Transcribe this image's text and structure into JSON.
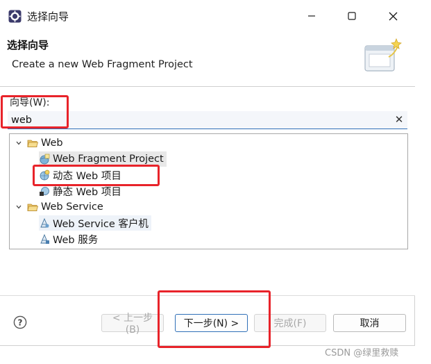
{
  "window": {
    "title": "选择向导",
    "minimize_icon": "minimize-icon",
    "maximize_icon": "maximize-icon",
    "close_icon": "close-icon"
  },
  "banner": {
    "title": "选择向导",
    "description": "Create a new Web Fragment Project",
    "image_icon": "wizard-banner-icon"
  },
  "filter": {
    "label": "向导(W):",
    "value": "web",
    "clear_icon": "clear-icon",
    "clear_glyph": "✕"
  },
  "tree": {
    "items": [
      {
        "label": "Web",
        "icon": "folder-open-icon",
        "expanded": true,
        "level": 0
      },
      {
        "label": "Web Fragment Project",
        "icon": "web-fragment-icon",
        "level": 1,
        "selected": true
      },
      {
        "label": "动态 Web 项目",
        "icon": "dynamic-web-icon",
        "level": 1
      },
      {
        "label": "静态 Web 项目",
        "icon": "static-web-icon",
        "level": 1
      },
      {
        "label": "Web Service",
        "icon": "folder-open-icon",
        "expanded": true,
        "level": 0
      },
      {
        "label": "Web Service 客户机",
        "icon": "ws-client-icon",
        "level": 1,
        "selected": true
      },
      {
        "label": "Web 服务",
        "icon": "ws-service-icon",
        "level": 1
      }
    ]
  },
  "buttons": {
    "back": "< 上一步(B)",
    "next": "下一步(N) >",
    "finish": "完成(F)",
    "cancel": "取消"
  },
  "help_glyph": "?",
  "watermark": "CSDN @绿里救赎",
  "colors": {
    "annotation": "#e8232a",
    "focus": "#2f6fb7"
  }
}
